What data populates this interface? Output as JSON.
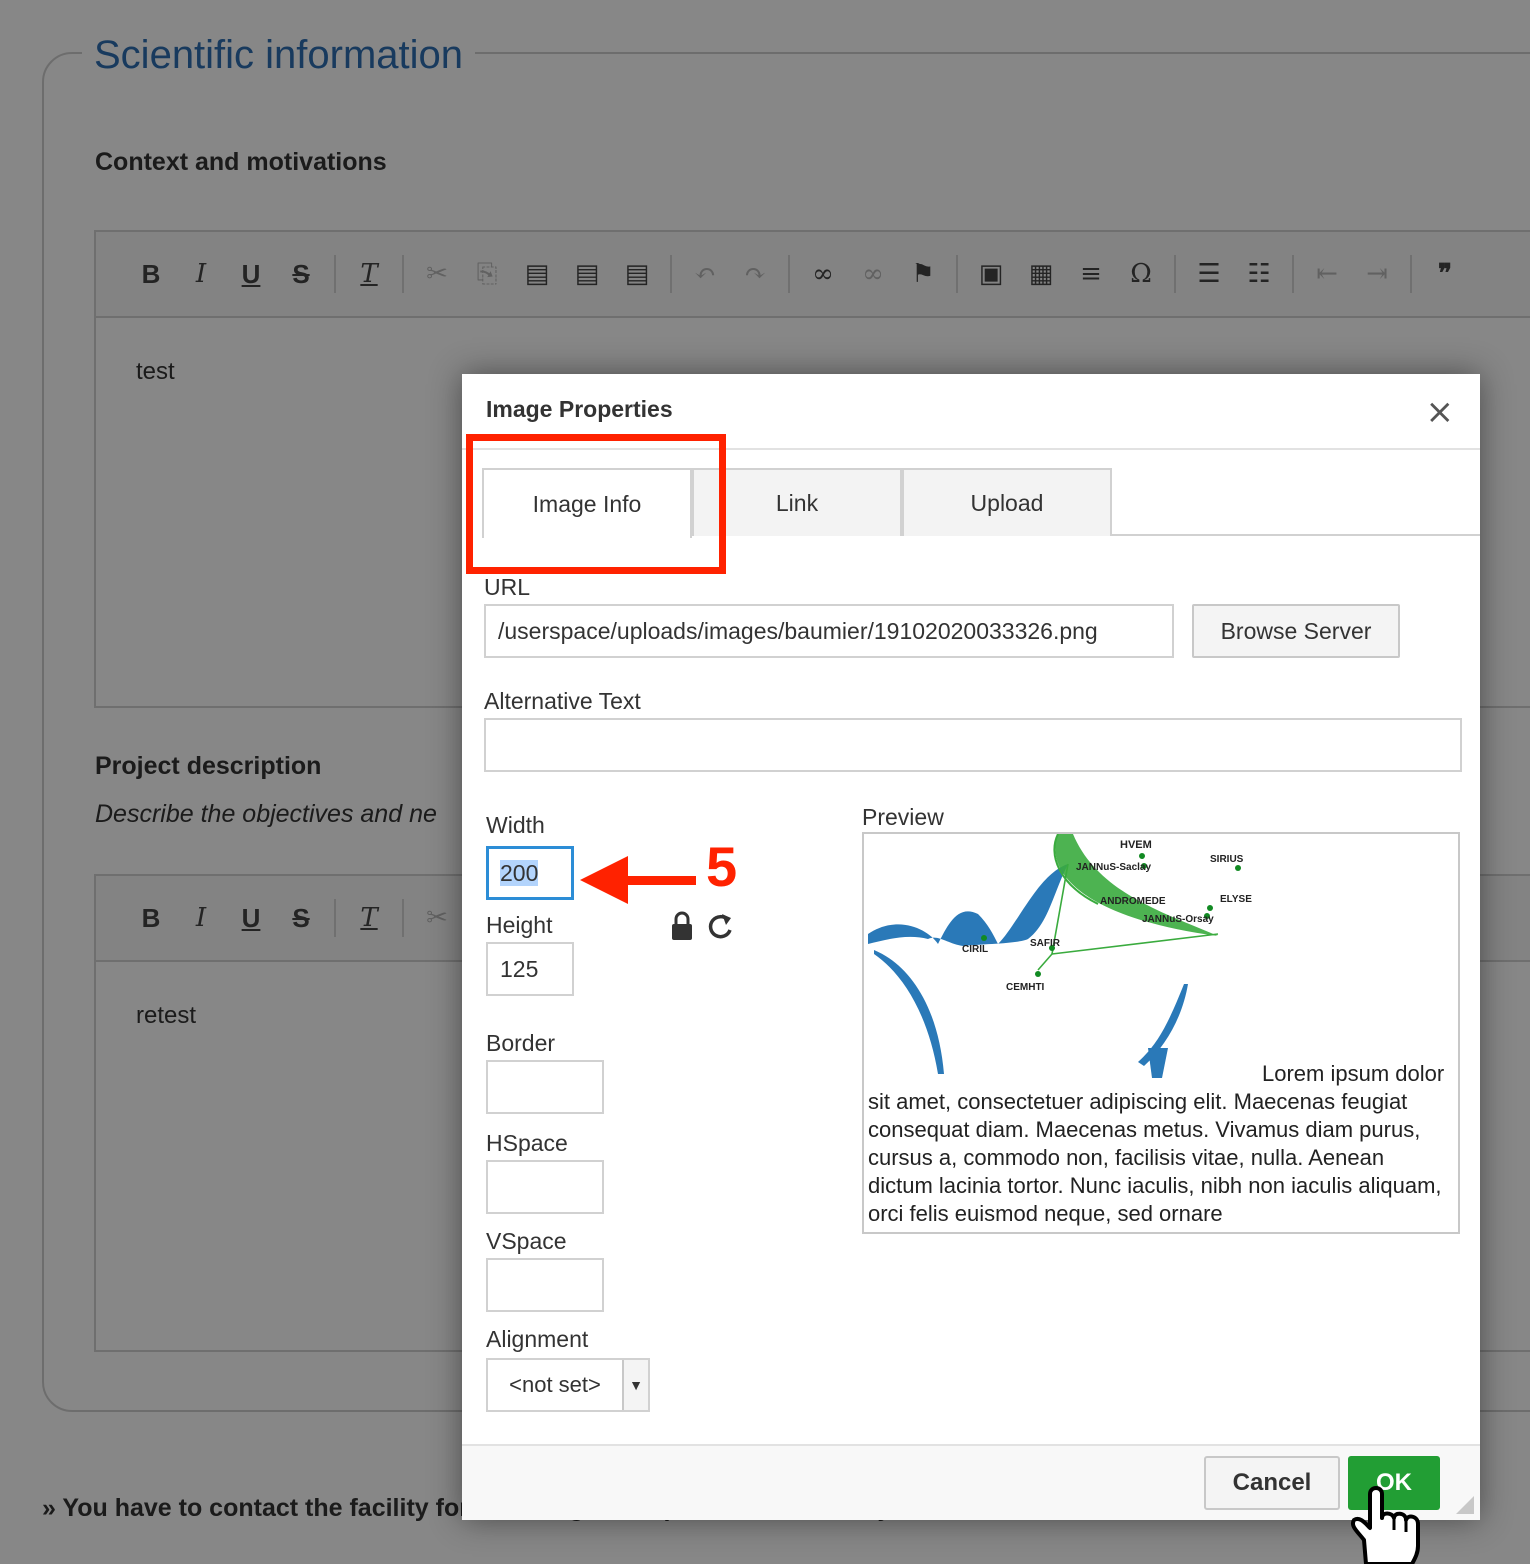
{
  "section": {
    "legend": "Scientific information",
    "context_title": "Context and motivations",
    "context_text": "test",
    "project_title": "Project description",
    "project_desc": "Describe the objectives and ne",
    "project_text": "retest",
    "contact_note": "» You have to contact the facility for checking the experiment feasibility before submission."
  },
  "toolbar_icons": [
    "bold-icon",
    "italic-icon",
    "underline-icon",
    "strike-icon",
    "remove-format-icon",
    "cut-icon",
    "copy-icon",
    "paste-icon",
    "paste-text-icon",
    "paste-word-icon",
    "undo-icon",
    "redo-icon",
    "link-icon",
    "unlink-icon",
    "anchor-icon",
    "image-icon",
    "table-icon",
    "horizontal-rule-icon",
    "special-char-icon",
    "numbered-list-icon",
    "bulleted-list-icon",
    "outdent-icon",
    "indent-icon",
    "blockquote-icon"
  ],
  "dialog": {
    "title": "Image Properties",
    "close": "×",
    "tabs": [
      {
        "label": "Image Info"
      },
      {
        "label": "Link"
      },
      {
        "label": "Upload"
      }
    ],
    "url_label": "URL",
    "url_value": "/userspace/uploads/images/baumier/19102020033326.png",
    "browse_label": "Browse Server",
    "alt_label": "Alternative Text",
    "alt_value": "",
    "width_label": "Width",
    "width_value": "200",
    "height_label": "Height",
    "height_value": "125",
    "border_label": "Border",
    "hspace_label": "HSpace",
    "vspace_label": "VSpace",
    "alignment_label": "Alignment",
    "alignment_value": "<not set>",
    "preview_label": "Preview",
    "preview_text": "Lorem ipsum dolor sit amet, consectetuer adipiscing elit. Maecenas feugiat consequat diam. Maecenas metus. Vivamus diam purus, cursus a, commodo non, facilisis vitae, nulla. Aenean dictum lacinia tortor. Nunc iaculis, nibh non iaculis aliquam, orci felis euismod neque, sed ornare",
    "map_labels": [
      "HVEM",
      "JANNuS-Saclay",
      "SIRIUS",
      "ANDROMEDE",
      "ELYSE",
      "JANNuS-Orsay",
      "SAFIR",
      "CIRIL",
      "CEMHTI"
    ],
    "cancel_label": "Cancel",
    "ok_label": "OK"
  },
  "annotation": {
    "step_number": "5",
    "color": "#ff2200"
  }
}
